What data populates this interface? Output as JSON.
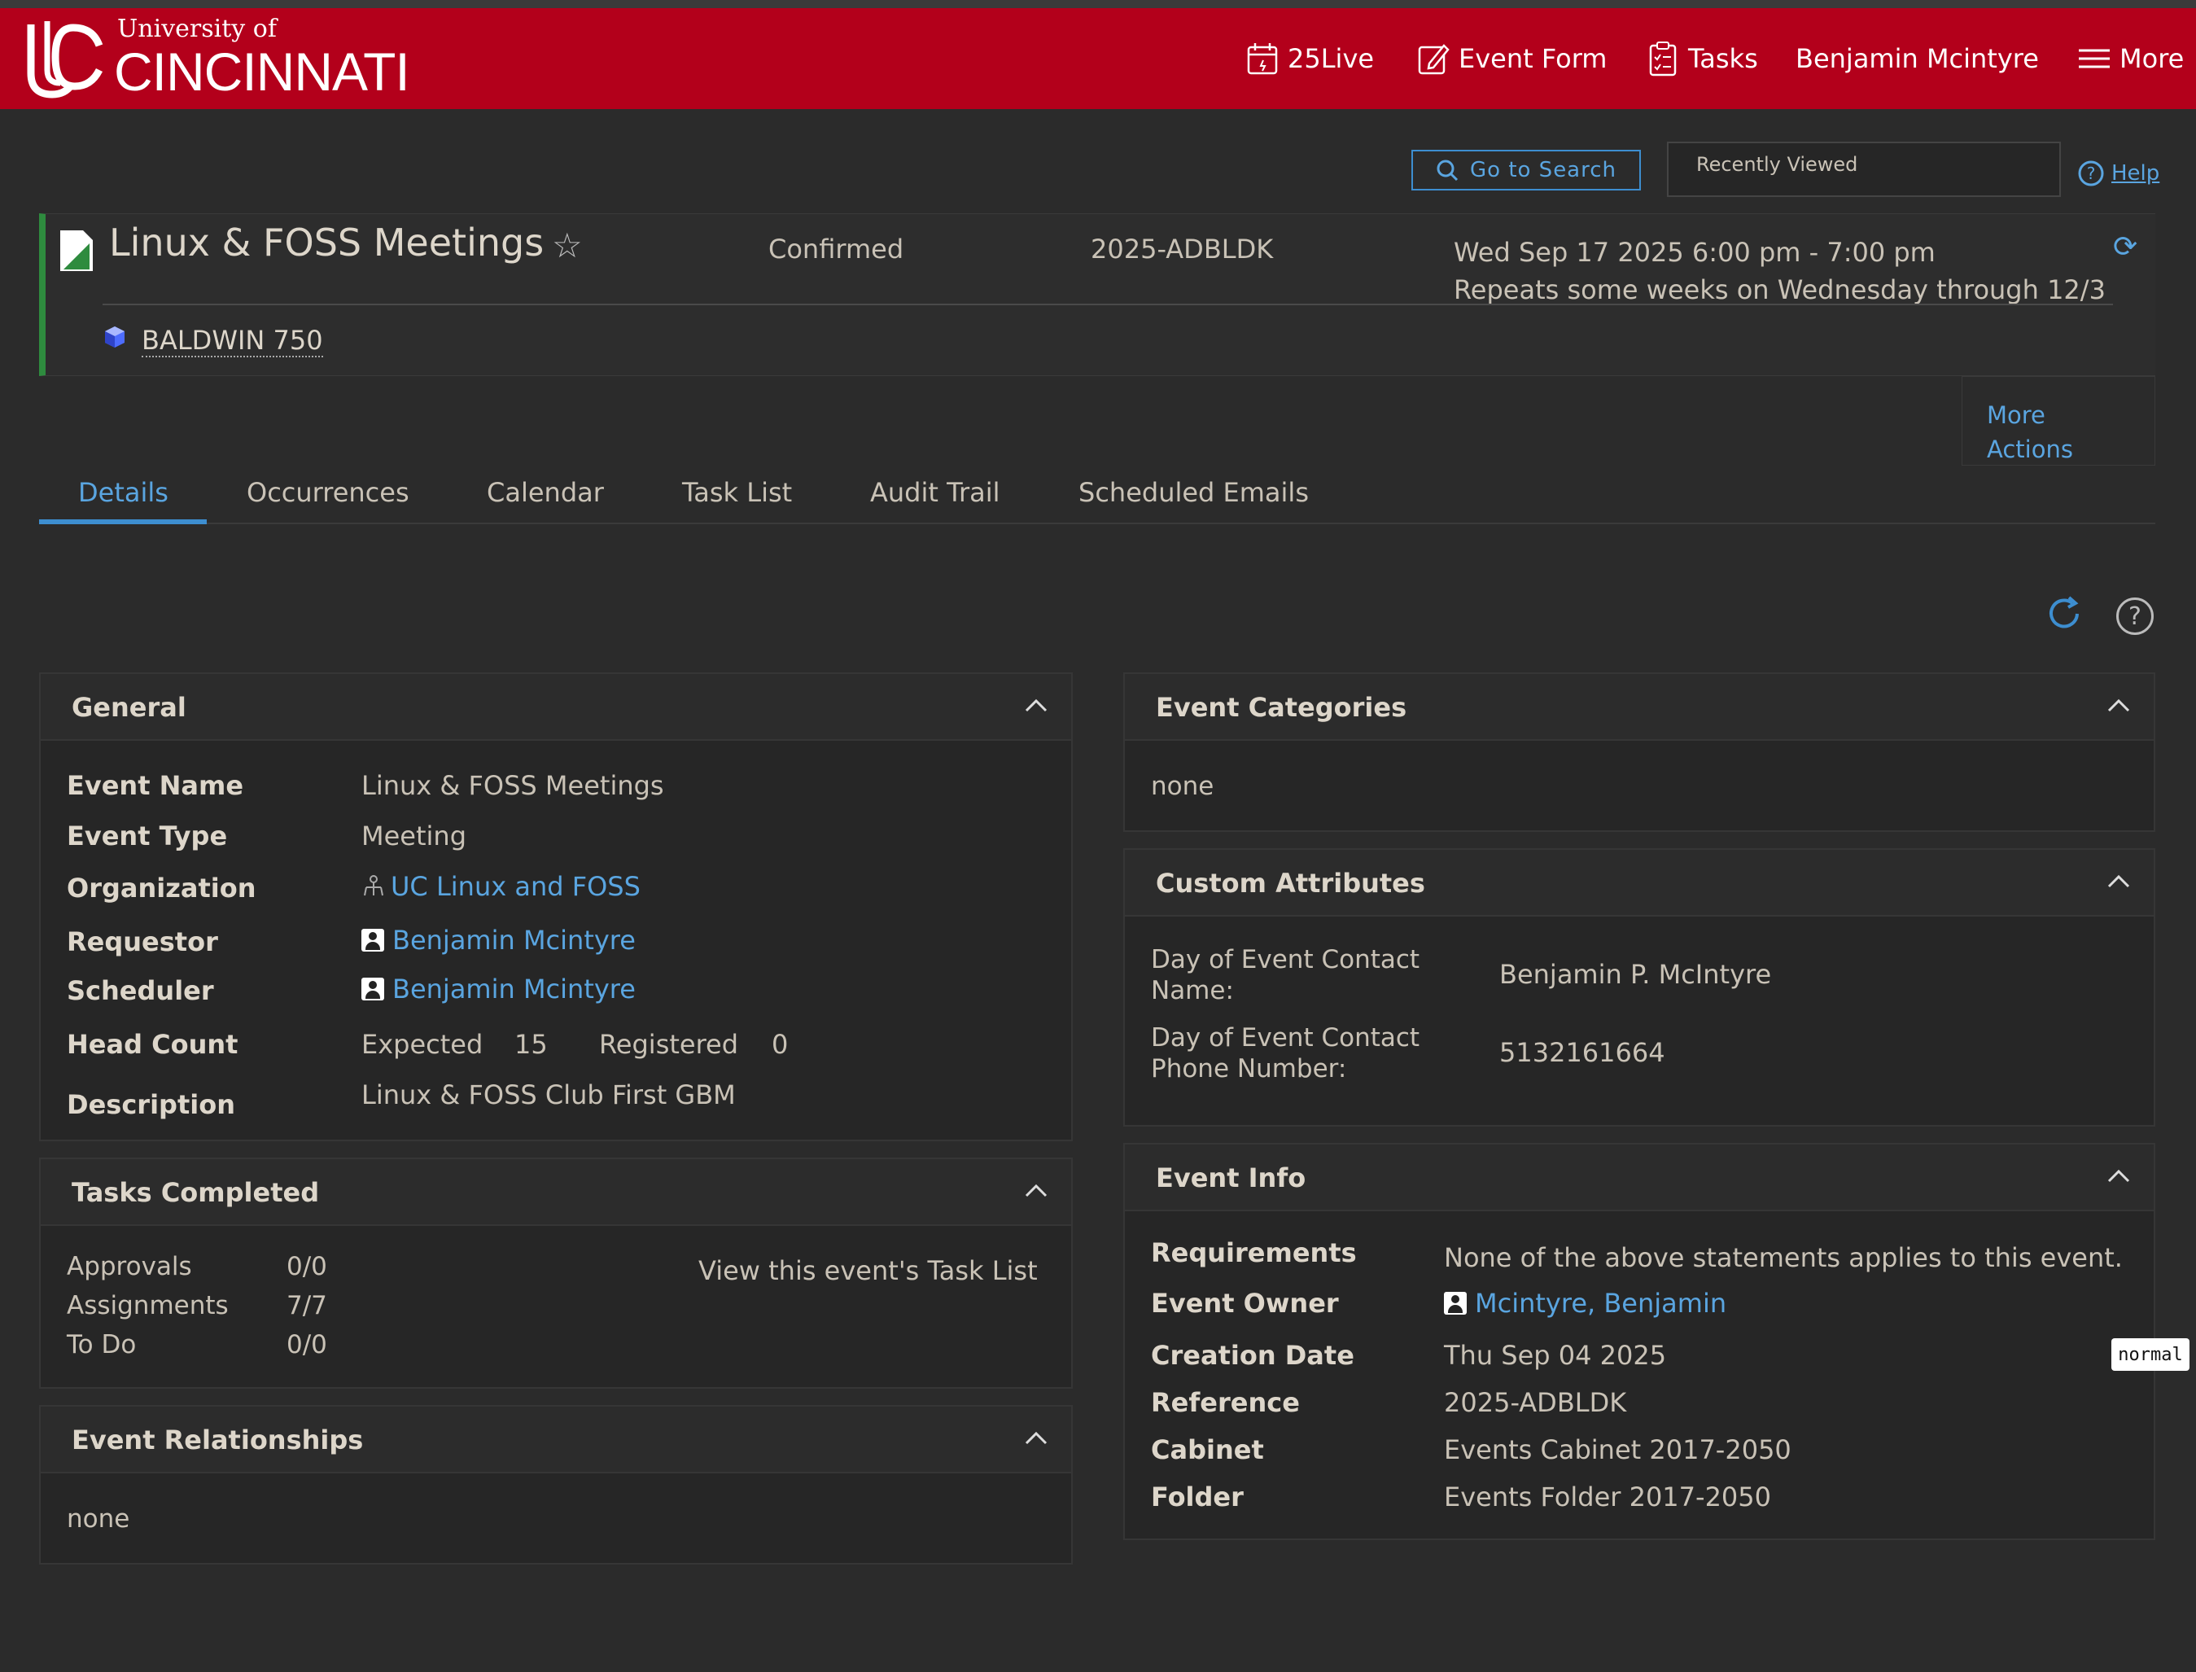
{
  "header": {
    "logo_small": "University of",
    "logo_large": "CINCINNATI",
    "nav": {
      "live": "25Live",
      "event_form": "Event Form",
      "tasks": "Tasks",
      "user": "Benjamin Mcintyre",
      "more": "More"
    }
  },
  "toolbar": {
    "search_label": "Go to Search",
    "recently_viewed": "Recently Viewed",
    "help_label": "Help"
  },
  "event": {
    "title": "Linux & FOSS Meetings",
    "state": "Confirmed",
    "reference": "2025-ADBLDK",
    "date_line1": "Wed Sep 17 2025 6:00 pm - 7:00 pm",
    "date_line2": "Repeats some weeks on Wednesday through 12/3",
    "location": "BALDWIN 750",
    "more_actions_1": "More",
    "more_actions_2": "Actions"
  },
  "tabs": [
    "Details",
    "Occurrences",
    "Calendar",
    "Task List",
    "Audit Trail",
    "Scheduled Emails"
  ],
  "general": {
    "title": "General",
    "event_name_label": "Event Name",
    "event_name": "Linux & FOSS Meetings",
    "event_type_label": "Event Type",
    "event_type": "Meeting",
    "organization_label": "Organization",
    "organization": "UC Linux and FOSS",
    "requestor_label": "Requestor",
    "requestor": "Benjamin Mcintyre",
    "scheduler_label": "Scheduler",
    "scheduler": "Benjamin Mcintyre",
    "head_count_label": "Head Count",
    "expected_label": "Expected",
    "expected": "15",
    "registered_label": "Registered",
    "registered": "0",
    "description_label": "Description",
    "description": "Linux & FOSS Club First GBM"
  },
  "tasks_completed": {
    "title": "Tasks Completed",
    "approvals_label": "Approvals",
    "approvals": "0/0",
    "assignments_label": "Assignments",
    "assignments": "7/7",
    "todo_label": "To Do",
    "todo": "0/0",
    "view_link": "View this event's Task List"
  },
  "relationships": {
    "title": "Event Relationships",
    "value": "none"
  },
  "categories": {
    "title": "Event Categories",
    "value": "none"
  },
  "custom_attributes": {
    "title": "Custom Attributes",
    "contact_name_label_1": "Day of Event Contact",
    "contact_name_label_2": "Name:",
    "contact_name": "Benjamin P. McIntyre",
    "contact_phone_label_1": "Day of Event Contact",
    "contact_phone_label_2": "Phone Number:",
    "contact_phone": "5132161664"
  },
  "event_info": {
    "title": "Event Info",
    "requirements_label": "Requirements",
    "requirements": "None of the above statements applies to this event.",
    "owner_label": "Event Owner",
    "owner": "Mcintyre, Benjamin",
    "creation_label": "Creation Date",
    "creation": "Thu Sep 04 2025",
    "reference_label": "Reference",
    "reference": "2025-ADBLDK",
    "cabinet_label": "Cabinet",
    "cabinet": "Events Cabinet 2017-2050",
    "folder_label": "Folder",
    "folder": "Events Folder 2017-2050"
  },
  "overlay_tag": "normal",
  "colors": {
    "brand_red": "#b3001b",
    "link_blue": "#5aa5e0",
    "status_green": "#2e8b3e",
    "background": "#2b2b2b"
  },
  "icons": [
    "calendar-icon",
    "edit-icon",
    "clipboard-icon",
    "menu-icon",
    "search-icon",
    "help-icon",
    "star-icon",
    "refresh-icon",
    "location-cube-icon",
    "chevron-up-icon",
    "person-icon",
    "org-icon"
  ]
}
